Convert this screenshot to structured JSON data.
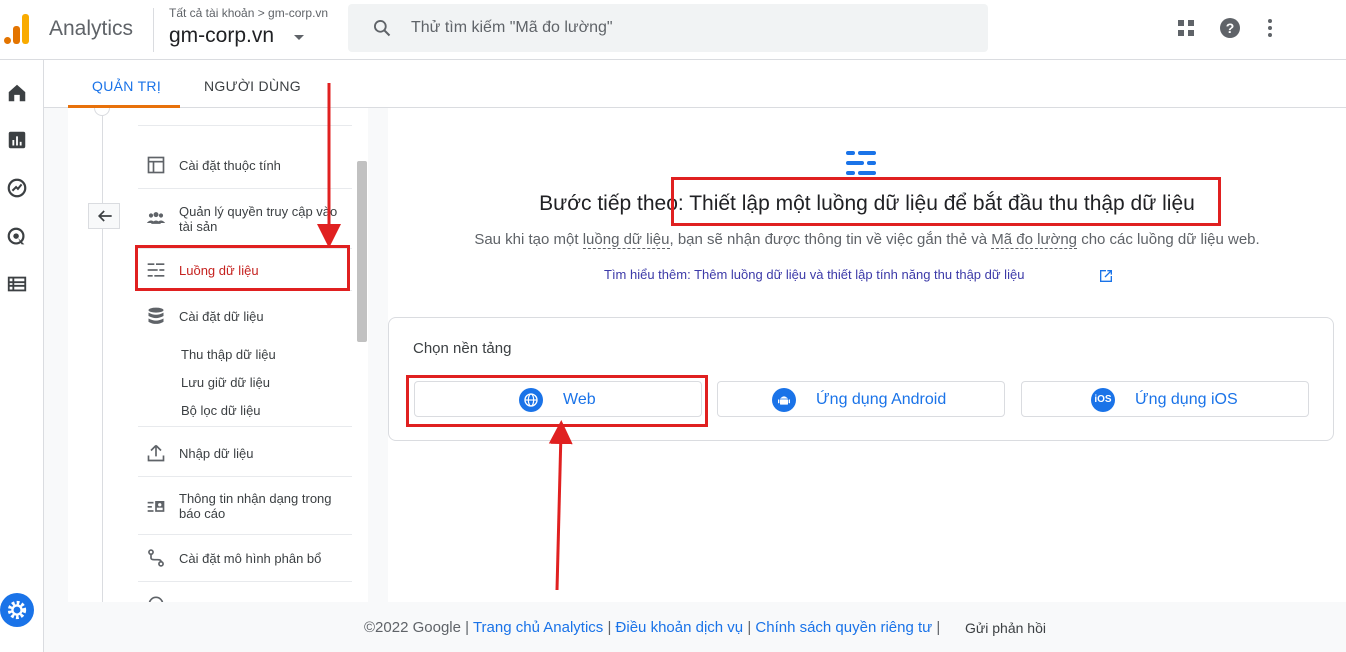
{
  "topbar": {
    "app_title": "Analytics",
    "account_breadcrumb": "Tất cả tài khoản > gm-corp.vn",
    "account_name": "gm-corp.vn",
    "search_placeholder": "Thử tìm kiếm \"Mã đo lường\""
  },
  "tabs": {
    "admin": "QUẢN TRỊ",
    "users": "NGƯỜI DÙNG"
  },
  "sidebar": {
    "items": [
      {
        "label": "Cài đặt thuộc tính",
        "icon": "layout-icon"
      },
      {
        "label": "Quản lý quyền truy cập vào tài sản",
        "icon": "people-icon"
      },
      {
        "label": "Luồng dữ liệu",
        "icon": "streams-icon"
      },
      {
        "label": "Cài đặt dữ liệu",
        "icon": "database-icon"
      },
      {
        "label": "Nhập dữ liệu",
        "icon": "upload-icon"
      },
      {
        "label": "Thông tin nhận dạng trong báo cáo",
        "icon": "id-card-icon"
      },
      {
        "label": "Cài đặt mô hình phân bổ",
        "icon": "route-icon"
      }
    ],
    "sub_items": [
      "Thu thập dữ liệu",
      "Lưu giữ dữ liệu",
      "Bộ lọc dữ liệu"
    ]
  },
  "main": {
    "heading_prefix": "Bước tiếp theo: ",
    "heading_main": "Thiết lập một luồng dữ liệu để bắt đầu thu thập dữ liệu",
    "sub_a": "Sau khi tạo một ",
    "sub_term1": "luồng dữ liệu",
    "sub_b": ", bạn sẽ nhận được thông tin về việc gắn thẻ và ",
    "sub_term2": "Mã đo lường",
    "sub_c": " cho các luồng dữ liệu web.",
    "learn_more": "Tìm hiểu thêm: Thêm luồng dữ liệu và thiết lập tính năng thu thập dữ liệu",
    "platform_title": "Chọn nền tảng",
    "platforms": [
      {
        "label": "Web",
        "icon": "globe-icon"
      },
      {
        "label": "Ứng dụng Android",
        "icon": "android-icon"
      },
      {
        "label": "Ứng dụng iOS",
        "icon": "ios-icon",
        "badge": "iOS"
      }
    ]
  },
  "footer": {
    "copyright": "©2022 Google",
    "sep": "|",
    "links": [
      "Trang chủ Analytics",
      "Điều khoản dịch vụ",
      "Chính sách quyền riêng tư"
    ],
    "feedback": "Gửi phản hồi"
  },
  "colors": {
    "accent_blue": "#1a73e8",
    "tab_underline": "#e8710a",
    "annotation_red": "#e02020"
  }
}
